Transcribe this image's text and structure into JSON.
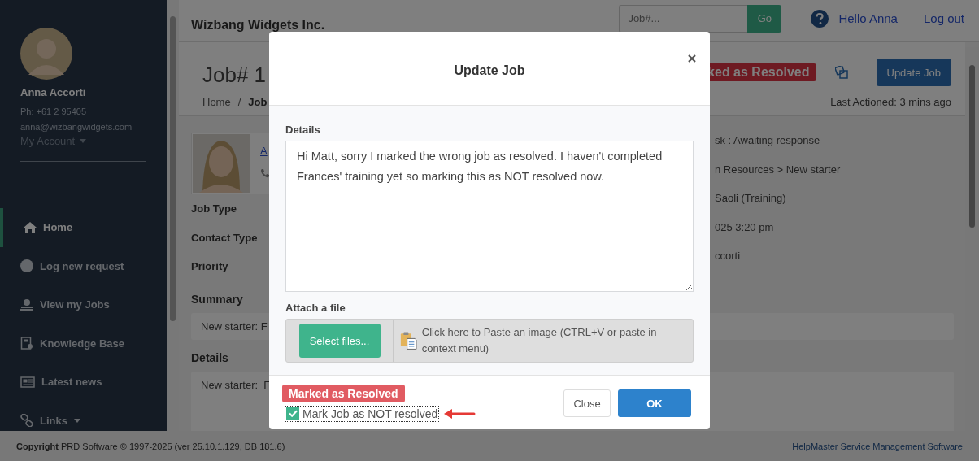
{
  "sidebar": {
    "user": {
      "name": "Anna Accorti",
      "phone": "Ph: +61 2 95405",
      "email": "anna@wizbangwidgets.com",
      "account_menu": "My Account"
    },
    "nav": [
      {
        "label": "Home",
        "kind": "home",
        "selected": true,
        "has_menu": false
      },
      {
        "label": "Log new request",
        "kind": "request",
        "selected": false,
        "has_menu": false
      },
      {
        "label": "View my Jobs",
        "kind": "jobs",
        "selected": false,
        "has_menu": false
      },
      {
        "label": "Knowledge Base",
        "kind": "knowledge",
        "selected": false,
        "has_menu": false
      },
      {
        "label": "Latest news",
        "kind": "news",
        "selected": false,
        "has_menu": false
      },
      {
        "label": "Links",
        "kind": "links",
        "selected": false,
        "has_menu": true
      }
    ]
  },
  "header": {
    "company": "Wizbang Widgets Inc.",
    "search": {
      "placeholder": "Job#...",
      "button": "Go"
    },
    "greeting": "Hello Anna",
    "logout": "Log out"
  },
  "job": {
    "title": "Job# 1",
    "breadcrumb": [
      "Home",
      "/",
      "Job"
    ],
    "status_badge": "ked as Resolved",
    "update_button": "Update Job",
    "last_actioned": "Last Actioned: 3 mins ago",
    "contact_link": "A",
    "labels": [
      "Job Type",
      "Contact Type",
      "Priority"
    ],
    "values": [
      "sk : Awaiting response",
      "n Resources > New starter",
      "Saoli (Training)",
      "025 3:20 pm",
      "ccorti"
    ],
    "summary_heading": "Summary",
    "summary": "New starter: F",
    "details_heading": "Details",
    "details": "New starter:  F"
  },
  "modal": {
    "title": "Update Job",
    "details_label": "Details",
    "details_value": "Hi Matt, sorry I marked the wrong job as resolved. I haven't completed Frances' training yet so marking this as NOT resolved now.",
    "attach_label": "Attach a file",
    "select_button": "Select files...",
    "paste_hint": "Click here to Paste an image (CTRL+V or paste in context menu)",
    "status_badge": "Marked as Resolved",
    "checkbox": {
      "label": "Mark Job as NOT resolved",
      "checked": true
    },
    "buttons": [
      {
        "label": "Close",
        "kind": "secondary"
      },
      {
        "label": "OK",
        "kind": "primary"
      }
    ]
  },
  "footer": {
    "copyright": "**Copyright** PRD Software © 1997-2025 (ver 25.10.1.129, DB 181.6)",
    "product_link": "HelpMaster Service Management Software"
  }
}
